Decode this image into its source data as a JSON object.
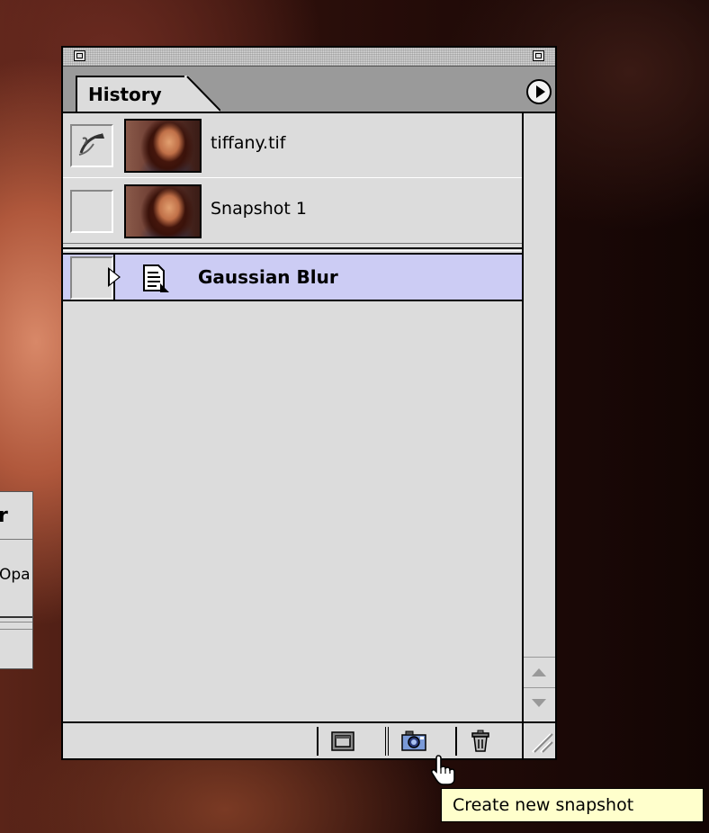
{
  "side_dialog": {
    "title_fragment": "r",
    "label_fragment": "Opa"
  },
  "panel": {
    "tab_label": "History",
    "snapshots": [
      {
        "label": "tiffany.tif",
        "has_brush_source": true
      },
      {
        "label": "Snapshot 1",
        "has_brush_source": false
      }
    ],
    "states": [
      {
        "label": "Gaussian Blur",
        "selected": true
      }
    ],
    "bottom_buttons": [
      {
        "name": "new-document-from-state",
        "icon": "document-icon"
      },
      {
        "name": "create-new-snapshot",
        "icon": "camera-icon"
      },
      {
        "name": "delete-state",
        "icon": "trash-icon"
      }
    ]
  },
  "tooltip": {
    "text": "Create new snapshot"
  },
  "colors": {
    "selected_row": "#ccccf4",
    "panel_bg": "#dcdcdc",
    "tooltip_bg": "#ffffcc"
  }
}
